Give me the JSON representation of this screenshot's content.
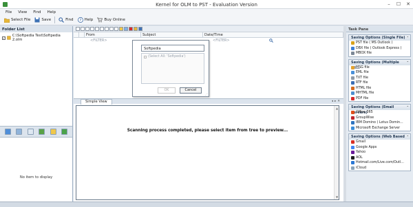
{
  "window": {
    "title": "Kernel for OLM to PST - Evaluation Version",
    "min": "–",
    "max": "☐",
    "close": "✕"
  },
  "menu": [
    "File",
    "View",
    "Find",
    "Help"
  ],
  "toolbar": {
    "select_file": "Select File",
    "save": "Save",
    "find": "Find",
    "help": "Help",
    "buy_online": "Buy Online"
  },
  "folder_list": {
    "title": "Folder List",
    "path": "C:\\Softpedia Test\\Softpedia 2.olm",
    "empty_text": "No item to display"
  },
  "grid": {
    "columns": [
      "From",
      "Subject",
      "Date/Time"
    ],
    "filter_placeholder": "<FILTER>"
  },
  "filter_dialog": {
    "input_value": "Softpedia",
    "option": "(Select All: 'Softpedia')",
    "ok": "OK",
    "cancel": "Cancel"
  },
  "preview": {
    "tab": "Simple View",
    "message": "Scanning process completed, please select item from tree to preview..."
  },
  "task_pane": {
    "title": "Task Pane",
    "groups": [
      {
        "title": "Saving Options (Single File)",
        "items": [
          {
            "label": "PST file ( MS Outlook )",
            "color": "#d9a21b"
          },
          {
            "label": "DBX file ( Outlook Express )",
            "color": "#3f7fd6"
          },
          {
            "label": "MBOX file",
            "color": "#7c8896"
          }
        ]
      },
      {
        "title": "Saving Options (Multiple Fil...",
        "items": [
          {
            "label": "MSG file",
            "color": "#e2a12d"
          },
          {
            "label": "EML file",
            "color": "#4a90d9"
          },
          {
            "label": "TXT file",
            "color": "#8f9aa6"
          },
          {
            "label": "RTF file",
            "color": "#3b6fb6"
          },
          {
            "label": "HTML file",
            "color": "#d46a1f"
          },
          {
            "label": "MHTML file",
            "color": "#4d8fcf"
          },
          {
            "label": "PDF file",
            "color": "#d62b2b"
          }
        ]
      },
      {
        "title": "Saving Options (Email Servers)",
        "items": [
          {
            "label": "Office 365",
            "color": "#e04e1b"
          },
          {
            "label": "GroupWise",
            "color": "#c0272d"
          },
          {
            "label": "IBM Domino ( Lotus Domin...",
            "color": "#2f74c0"
          },
          {
            "label": "Microsoft Exchange Server",
            "color": "#3c8dd8"
          }
        ]
      },
      {
        "title": "Saving Options (Web Based ...",
        "items": [
          {
            "label": "Gmail",
            "color": "#d93025"
          },
          {
            "label": "Google Apps",
            "color": "#4285f4"
          },
          {
            "label": "Yahoo",
            "color": "#6a1b9a"
          },
          {
            "label": "AOL",
            "color": "#1f1f1f"
          },
          {
            "label": "Hotmail.com/Live.com/Outl...",
            "color": "#2b78d4"
          },
          {
            "label": "iCloud",
            "color": "#8aa3b8"
          }
        ]
      }
    ]
  },
  "colors": {
    "accent": "#1f3550",
    "panel": "#e5ebf2",
    "pdf_red": "#d62b2b"
  }
}
